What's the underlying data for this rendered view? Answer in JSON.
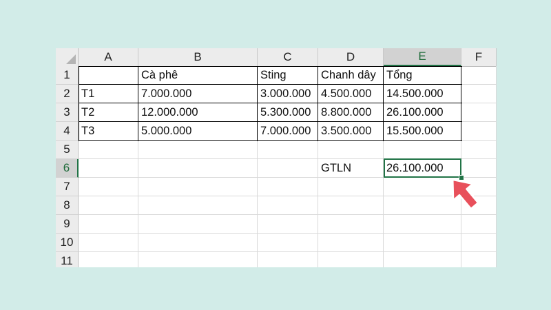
{
  "sheet": {
    "columns": [
      "A",
      "B",
      "C",
      "D",
      "E",
      "F"
    ],
    "rows": [
      "1",
      "2",
      "3",
      "4",
      "5",
      "6",
      "7",
      "8",
      "9",
      "10",
      "11"
    ],
    "cells": {
      "B1": "Cà phê",
      "C1": "Sting",
      "D1": "Chanh dây",
      "E1": "Tổng",
      "A2": "T1",
      "B2": "7.000.000",
      "C2": "3.000.000",
      "D2": "4.500.000",
      "E2": "14.500.000",
      "A3": "T2",
      "B3": "12.000.000",
      "C3": "5.300.000",
      "D3": "8.800.000",
      "E3": "26.100.000",
      "A4": "T3",
      "B4": "5.000.000",
      "C4": "7.000.000",
      "D4": "3.500.000",
      "E4": "15.500.000",
      "D6": "GTLN",
      "E6": "26.100.000"
    },
    "active_cell": "E6"
  },
  "colors": {
    "background": "#d2ece8",
    "selection": "#217346",
    "arrow": "#e8505b"
  },
  "icons": {
    "select_all": "select-all-triangle-icon",
    "pointer": "arrow-pointer-icon"
  }
}
